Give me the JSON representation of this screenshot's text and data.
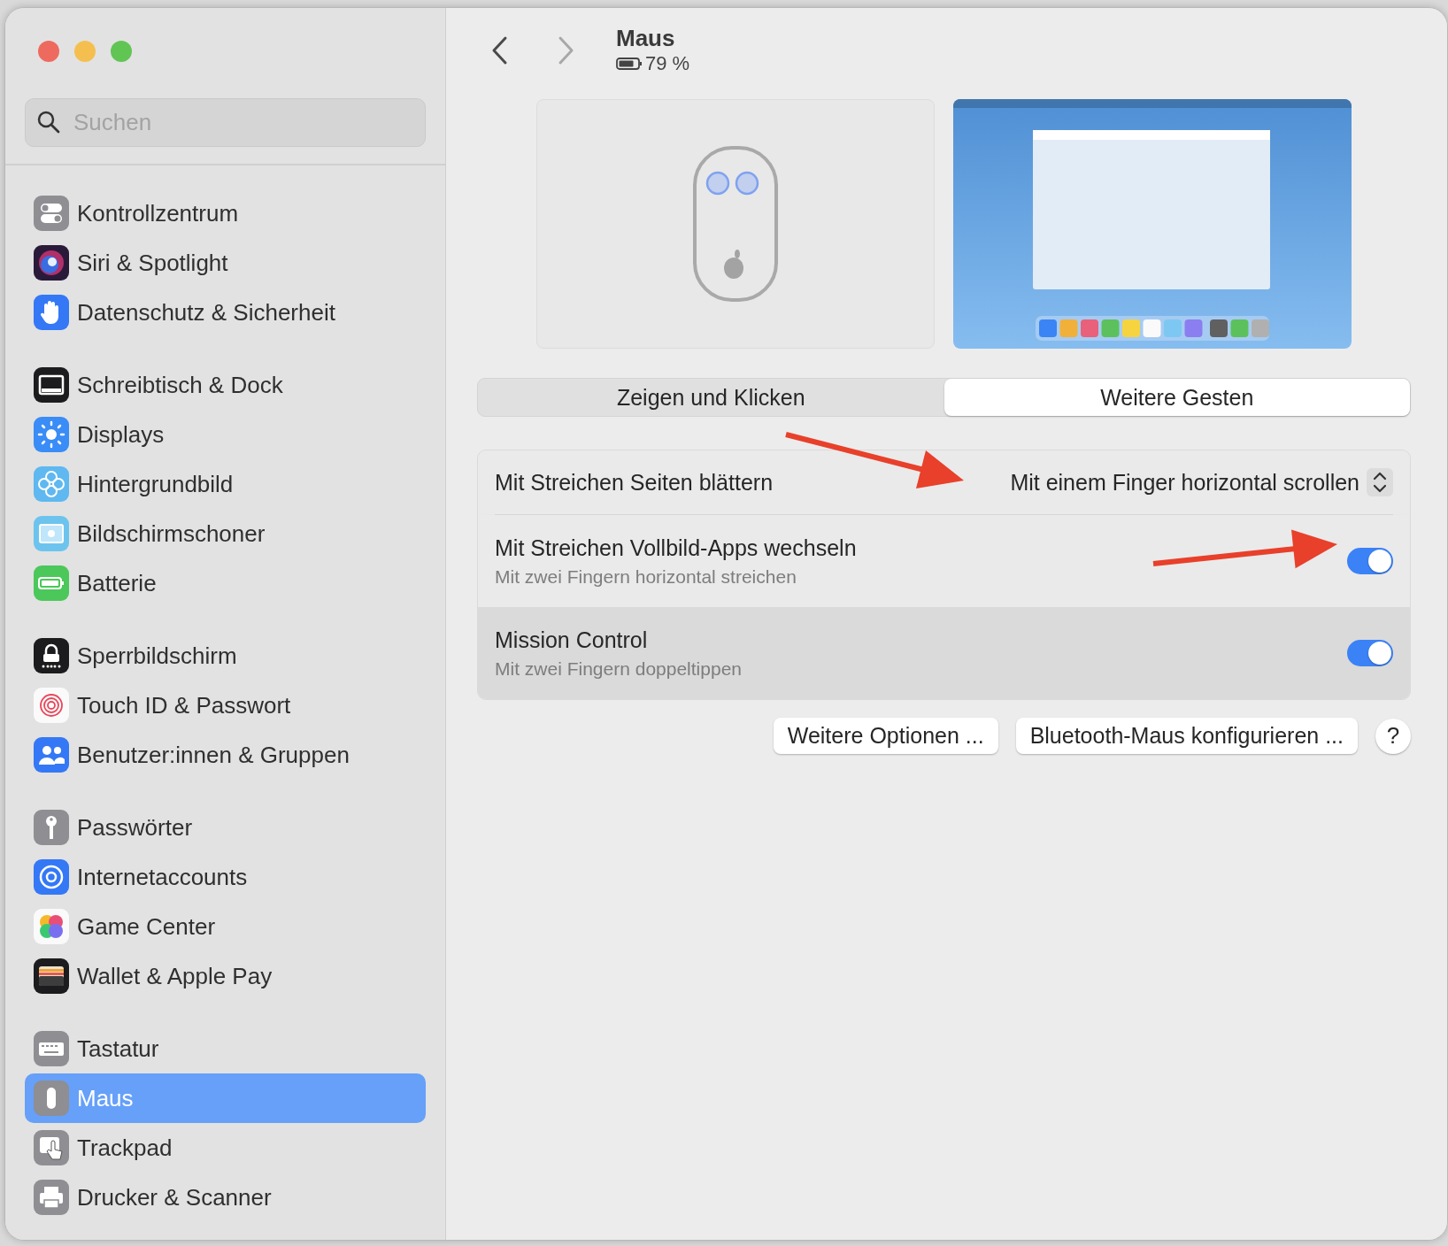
{
  "sidebar": {
    "search": {
      "placeholder": "Suchen"
    },
    "groups": [
      {
        "items": [
          {
            "label": "Kontrollzentrum",
            "selected": false
          },
          {
            "label": "Siri & Spotlight",
            "selected": false
          },
          {
            "label": "Datenschutz & Sicherheit",
            "selected": false
          }
        ]
      },
      {
        "items": [
          {
            "label": "Schreibtisch & Dock",
            "selected": false
          },
          {
            "label": "Displays",
            "selected": false
          },
          {
            "label": "Hintergrundbild",
            "selected": false
          },
          {
            "label": "Bildschirmschoner",
            "selected": false
          },
          {
            "label": "Batterie",
            "selected": false
          }
        ]
      },
      {
        "items": [
          {
            "label": "Sperrbildschirm",
            "selected": false
          },
          {
            "label": "Touch ID & Passwort",
            "selected": false
          },
          {
            "label": "Benutzer:innen & Gruppen",
            "selected": false
          }
        ]
      },
      {
        "items": [
          {
            "label": "Passwörter",
            "selected": false
          },
          {
            "label": "Internetaccounts",
            "selected": false
          },
          {
            "label": "Game Center",
            "selected": false
          },
          {
            "label": "Wallet & Apple Pay",
            "selected": false
          }
        ]
      },
      {
        "items": [
          {
            "label": "Tastatur",
            "selected": false
          },
          {
            "label": "Maus",
            "selected": true
          },
          {
            "label": "Trackpad",
            "selected": false
          },
          {
            "label": "Drucker & Scanner",
            "selected": false
          }
        ]
      }
    ]
  },
  "header": {
    "title": "Maus",
    "battery": "79 %"
  },
  "tabs": [
    {
      "label": "Zeigen und Klicken",
      "selected": false
    },
    {
      "label": "Weitere Gesten",
      "selected": true
    }
  ],
  "settings": [
    {
      "kind": "popup",
      "label": "Mit Streichen Seiten blättern",
      "value": "Mit einem Finger horizontal scrollen",
      "highlighted": false
    },
    {
      "kind": "toggle",
      "label": "Mit Streichen Vollbild-Apps wechseln",
      "subtitle": "Mit zwei Fingern horizontal streichen",
      "on": true,
      "highlighted": false
    },
    {
      "kind": "toggle",
      "label": "Mission Control",
      "subtitle": "Mit zwei Fingern doppeltippen",
      "on": true,
      "highlighted": true
    }
  ],
  "buttons": [
    "Weitere Optionen ...",
    "Bluetooth-Maus konfigurieren ..."
  ],
  "help_button": "?"
}
